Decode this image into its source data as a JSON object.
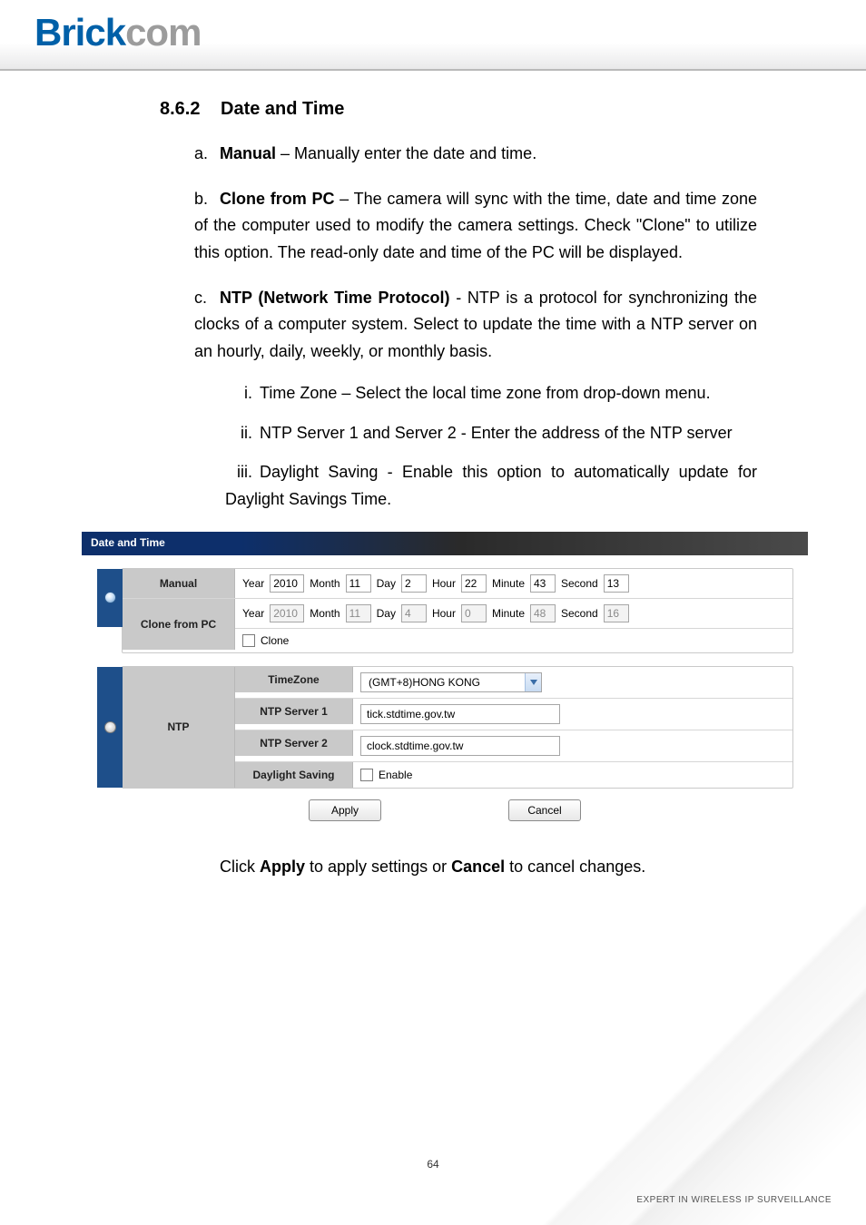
{
  "logo": {
    "part1": "Brick",
    "part2": "com"
  },
  "section": {
    "number": "8.6.2",
    "title": "Date and Time"
  },
  "items": {
    "a": {
      "letter": "a.",
      "label": "Manual",
      "text": " – Manually enter the date and time."
    },
    "b": {
      "letter": "b.",
      "label": "Clone from PC",
      "text": " – The camera will sync with the time, date and time zone of the computer used to modify the camera settings.  Check \"Clone\" to utilize this option.   The read-only date and time of the PC will be displayed."
    },
    "c": {
      "letter": "c.",
      "label": "NTP (Network Time Protocol)",
      "text": " - NTP is a protocol for synchronizing the clocks of a computer system.   Select to update the time with a NTP server on an hourly, daily, weekly, or monthly basis."
    },
    "c_sub": {
      "i": {
        "mark": "i.",
        "text": "Time Zone – Select the local time zone from drop-down menu."
      },
      "ii": {
        "mark": "ii.",
        "text": "NTP Server 1 and Server 2 - Enter the address of the NTP server"
      },
      "iii": {
        "mark": "iii.",
        "text": "Daylight Saving - Enable this option to automatically update for Daylight Savings Time."
      }
    }
  },
  "panel": {
    "header": "Date and Time",
    "labels": {
      "manual": "Manual",
      "clone_pc": "Clone from PC",
      "ntp": "NTP",
      "timezone": "TimeZone",
      "ntp1": "NTP Server 1",
      "ntp2": "NTP Server 2",
      "daylight": "Daylight Saving"
    },
    "fieldLabels": {
      "year": "Year",
      "month": "Month",
      "day": "Day",
      "hour": "Hour",
      "minute": "Minute",
      "second": "Second"
    },
    "manual": {
      "year": "2010",
      "month": "11",
      "day": "2",
      "hour": "22",
      "minute": "43",
      "second": "13"
    },
    "clonepc": {
      "year": "2010",
      "month": "11",
      "day": "4",
      "hour": "0",
      "minute": "48",
      "second": "16"
    },
    "cloneChk": "Clone",
    "timezone_value": "(GMT+8)HONG KONG",
    "ntp1_value": "tick.stdtime.gov.tw",
    "ntp2_value": "clock.stdtime.gov.tw",
    "daylight_enable": "Enable",
    "buttons": {
      "apply": "Apply",
      "cancel": "Cancel"
    }
  },
  "afterPanel": {
    "pre": "Click ",
    "b1": "Apply",
    "mid": " to apply settings or ",
    "b2": "Cancel",
    "post": " to cancel changes."
  },
  "pageNumber": "64",
  "footerTag": "EXPERT IN WIRELESS IP SURVEILLANCE"
}
